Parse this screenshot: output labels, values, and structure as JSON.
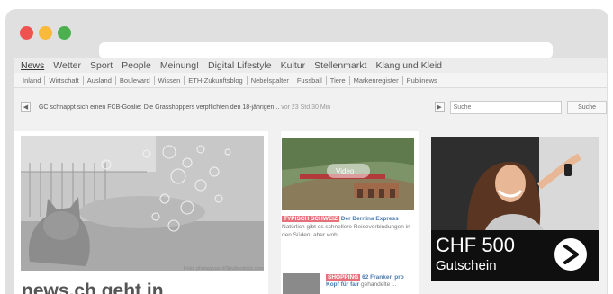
{
  "browser": {
    "dots": [
      "close",
      "minimize",
      "maximize"
    ]
  },
  "nav": {
    "main": [
      "News",
      "Wetter",
      "Sport",
      "People",
      "Meinung!",
      "Digital Lifestyle",
      "Kultur",
      "Stellenmarkt",
      "Klang und Kleid"
    ],
    "sub": [
      "Inland",
      "Wirtschaft",
      "Ausland",
      "Boulevard",
      "Wissen",
      "ETH-Zukunftsblog",
      "Nebelspalter",
      "Fussball",
      "Tiere",
      "Markenregister",
      "Publinews"
    ]
  },
  "ticker": {
    "headline": "GC schnappt sich einen FCB-Goalie: Die Grasshoppers verpflichten den 18-jährigen...",
    "time": "vor 23 Std 30 Min",
    "search_placeholder": "Suche",
    "search_button": "Suche"
  },
  "hero": {
    "credit": "Foto: photaqivashi/Shutterstock.com",
    "headline": "news.ch geht in"
  },
  "teasers": [
    {
      "badge": "TYPISCH SCHWEIZ",
      "link": "Der Bernina Express",
      "text": "Natürlich gibt es schnellere Reiseverbindungen in den Süden, aber wohl ..."
    },
    {
      "badge": "SHOPPING",
      "link": "62 Franken pro Kopf für fair",
      "text": "gehandelte ..."
    }
  ],
  "ad": {
    "price": "CHF 500",
    "subtitle": "Gutschein",
    "cta_icon": "arrow-right-icon"
  }
}
